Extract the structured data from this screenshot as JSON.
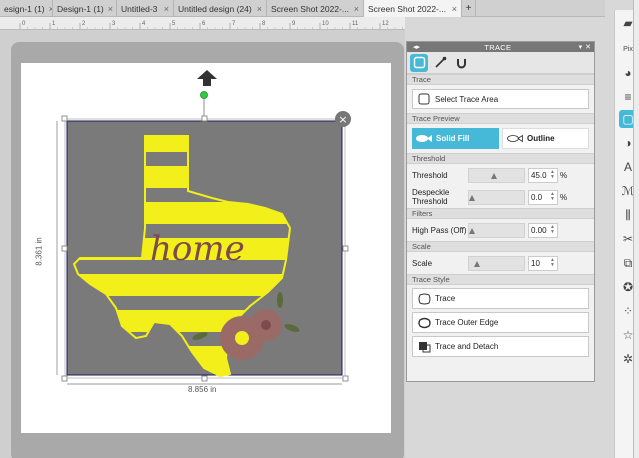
{
  "tabs": [
    {
      "label": "esign-1 (1)",
      "active": false
    },
    {
      "label": "Design-1 (1)",
      "active": false
    },
    {
      "label": "Untitled-3",
      "active": false
    },
    {
      "label": "Untitled design (24)",
      "active": false
    },
    {
      "label": "Screen Shot 2022-...",
      "active": false
    },
    {
      "label": "Screen Shot 2022-...",
      "active": true
    }
  ],
  "tab_close": "×",
  "tab_add": "+",
  "ruler": {
    "ticks": [
      "0",
      "1",
      "2",
      "3",
      "4",
      "5",
      "6",
      "7",
      "8",
      "9",
      "10",
      "11",
      "12"
    ]
  },
  "design": {
    "text": "home",
    "height_label": "8.361 in",
    "width_label": "8.856 in"
  },
  "panel": {
    "title": "TRACE",
    "sections": {
      "trace": "Trace",
      "trace_preview": "Trace Preview",
      "threshold": "Threshold",
      "filters": "Filters",
      "scale": "Scale",
      "trace_style": "Trace Style"
    },
    "select_trace_area": "Select Trace Area",
    "solid_fill": "Solid Fill",
    "outline": "Outline",
    "threshold": {
      "label": "Threshold",
      "value": "45.0",
      "unit": "%",
      "level": 0.45
    },
    "despeckle": {
      "label": "Despeckle Threshold",
      "value": "0.0",
      "unit": "%",
      "level": 0.0
    },
    "highpass": {
      "label": "High Pass (Off)",
      "value": "0.00",
      "level": 0.0
    },
    "scale": {
      "label": "Scale",
      "value": "10",
      "level": 0.1
    },
    "trace_btn": "Trace",
    "trace_outer_edge": "Trace Outer Edge",
    "trace_and_detach": "Trace and Detach"
  },
  "colors": {
    "accent": "#47b9d8",
    "mat_gray": "#7a7a7a",
    "texas_yellow": "#f2ef1a",
    "home_text": "#7d4a4d"
  },
  "toolbar_icons": [
    "page-icon",
    "pixscan-icon",
    "palette-icon",
    "lines-icon",
    "trace-icon",
    "contrast-icon",
    "text-icon",
    "sketch-icon",
    "align-icon",
    "knife-icon",
    "replicate-icon",
    "star-icon",
    "offset-icon",
    "outline-star-icon",
    "transform-icon"
  ]
}
